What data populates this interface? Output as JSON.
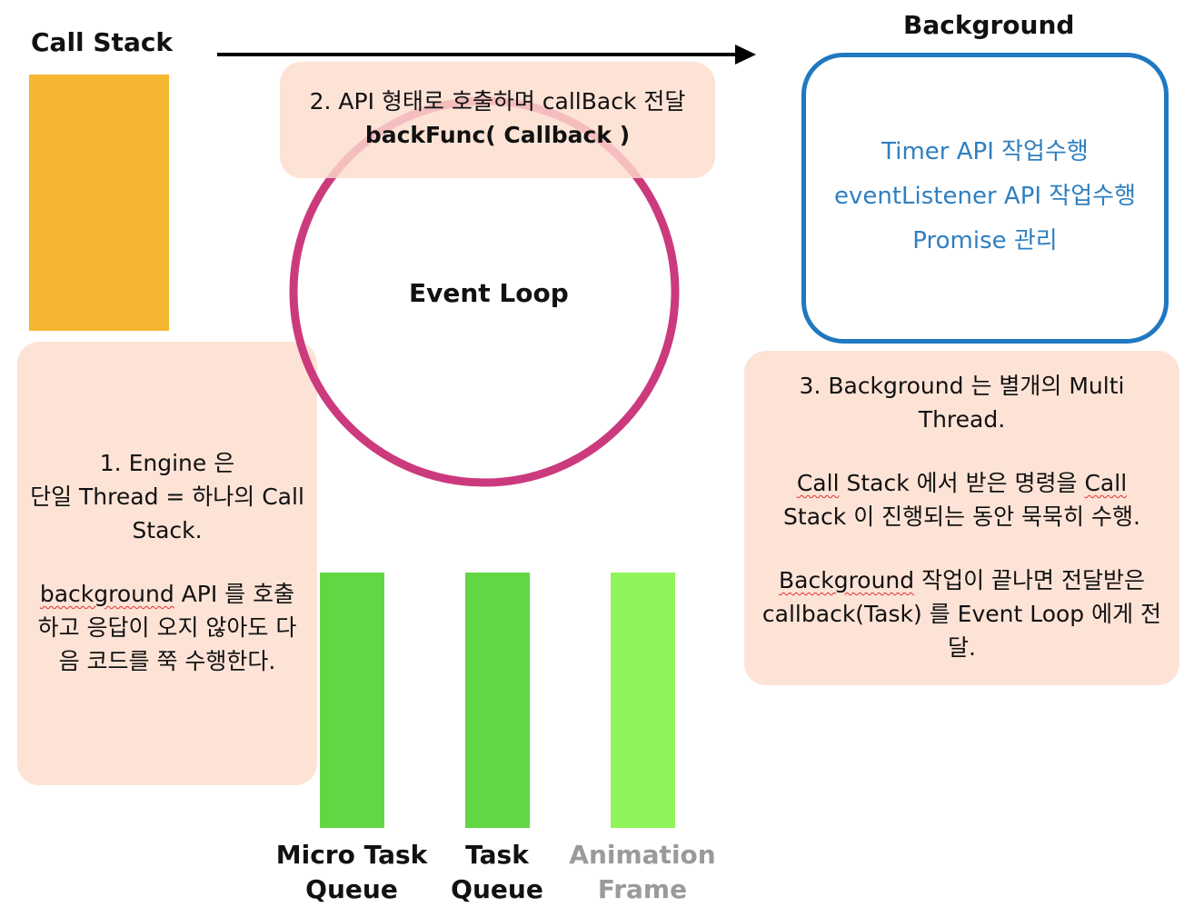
{
  "call_stack": {
    "title": "Call Stack"
  },
  "background": {
    "title": "Background",
    "items": [
      "Timer API 작업수행",
      "eventListener API 작업수행",
      "Promise 관리"
    ]
  },
  "event_loop": {
    "label": "Event Loop"
  },
  "note_api": {
    "line1": "2. API 형태로 호출하며 callBack 전달",
    "line2": "backFunc( Callback )"
  },
  "note_engine": {
    "p1_l1": "1. Engine 은",
    "p1_l2": "단일 Thread = 하나의 Call",
    "p1_l3": "Stack.",
    "p2_word": "background",
    "p2_l1_rest": " API 를 호출",
    "p2_l2": "하고 응답이 오지 않아도 다",
    "p2_l3": "음 코드를 쭉 수행한다."
  },
  "note_background": {
    "p1_l1": "3. Background 는 별개의 Multi",
    "p1_l2": "Thread.",
    "p2_word1": "Call",
    "p2_l1_mid": " Stack 에서 받은 명령을 ",
    "p2_word2": "Call",
    "p2_l2": "Stack 이 진행되는 동안 묵묵히 수행.",
    "p3_word": "Background",
    "p3_l1_rest": " 작업이 끝나면 전달받은",
    "p3_l2": "callback(Task) 를 Event Loop 에게 전",
    "p3_l3": "달."
  },
  "queues": [
    {
      "label_l1": "Micro Task",
      "label_l2": "Queue"
    },
    {
      "label_l1": "Task",
      "label_l2": "Queue"
    },
    {
      "label_l1": "Animation",
      "label_l2": "Frame"
    }
  ],
  "colors": {
    "call_stack": "#f5b731",
    "event_loop_ring": "#cc3a7e",
    "background_border": "#1f78c1",
    "background_text": "#2f7fc0",
    "note_bg": "#fde3d6",
    "micro_task_queue": "#62d744",
    "task_queue": "#62d744",
    "animation_frame": "#8ff45a",
    "animation_frame_label": "#9a9a9a"
  }
}
